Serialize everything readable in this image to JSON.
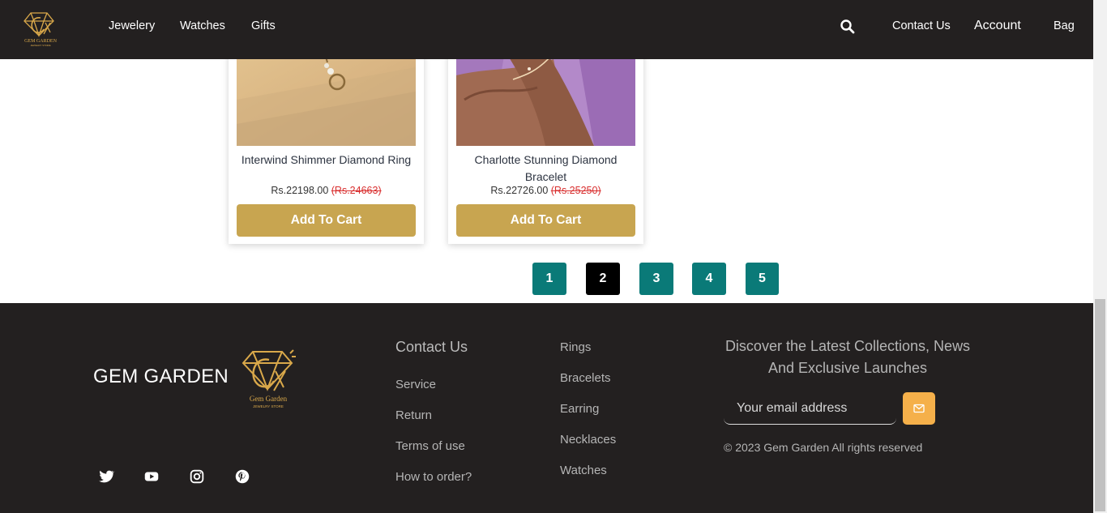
{
  "header": {
    "logo_text": "GEM GARDEN",
    "logo_subtext": "JEWELRY STORE",
    "nav": [
      "Jewelery",
      "Watches",
      "Gifts"
    ],
    "right_links": [
      "Contact Us",
      "Account",
      "Bag"
    ],
    "search_icon": "search-icon"
  },
  "products": [
    {
      "name": "Interwind Shimmer Diamond Ring",
      "price": "Rs.22198.00",
      "old_price": "(Rs.24663)",
      "button": "Add To Cart"
    },
    {
      "name": "Charlotte Stunning Diamond Bracelet",
      "price": "Rs.22726.00",
      "old_price": "(Rs.25250)",
      "button": "Add To Cart"
    }
  ],
  "pagination": {
    "pages": [
      "1",
      "2",
      "3",
      "4",
      "5"
    ],
    "active": "2"
  },
  "footer": {
    "brand": "GEM GARDEN",
    "logo_text": "Gem Garden",
    "logo_subtext": "JEWELRY STORE",
    "social_icons": [
      "twitter-icon",
      "youtube-icon",
      "instagram-icon",
      "pinterest-icon"
    ],
    "contact_heading": "Contact Us",
    "contact_links": [
      "Service",
      "Return",
      "Terms of use",
      "How to order?"
    ],
    "category_links": [
      "Rings",
      "Bracelets",
      "Earring",
      "Necklaces",
      "Watches"
    ],
    "newsletter_text": "Discover the Latest Collections, News And Exclusive Launches",
    "email_placeholder": "Your email address",
    "copyright": "© 2023 Gem Garden All rights reserved"
  },
  "colors": {
    "header_bg": "#232020",
    "gold": "#c8a550",
    "teal": "#0a7a78",
    "orange": "#f5b04a"
  }
}
